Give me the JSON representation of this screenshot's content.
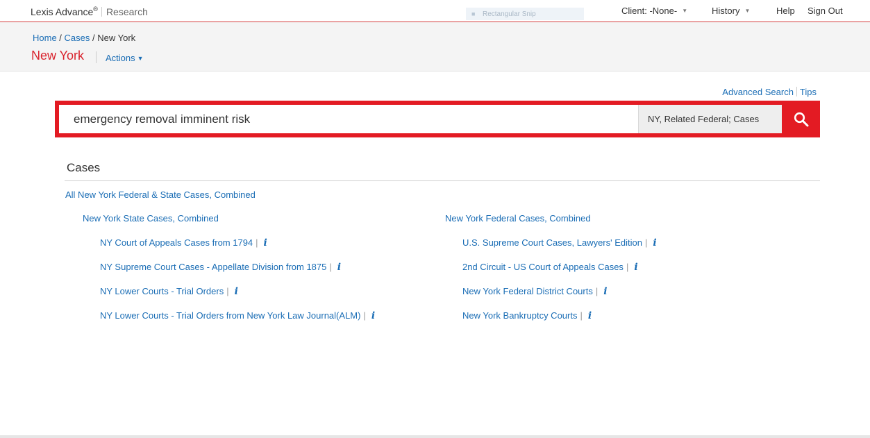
{
  "topbar": {
    "brand": "Lexis Advance",
    "brand_mark": "®",
    "product": "Research",
    "snip_label": "Rectangular Snip",
    "client_label": "Client: -None-",
    "history_label": "History",
    "help_label": "Help",
    "signout_label": "Sign Out"
  },
  "header": {
    "breadcrumb": {
      "home": "Home",
      "sep1": " / ",
      "cases": "Cases",
      "sep2": " / ",
      "current": "New York"
    },
    "title": "New York",
    "actions_label": "Actions"
  },
  "search": {
    "advanced_label": "Advanced Search",
    "tips_label": "Tips",
    "query": "emergency removal imminent risk",
    "scope": "NY, Related Federal; Cases"
  },
  "cases": {
    "heading": "Cases",
    "all_combined": "All New York Federal & State Cases, Combined",
    "state": {
      "combined": "New York State Cases, Combined",
      "items": [
        {
          "label": "NY Court of Appeals Cases from 1794"
        },
        {
          "label": "NY Supreme Court Cases - Appellate Division from 1875"
        },
        {
          "label": "NY Lower Courts - Trial Orders"
        },
        {
          "label": "NY Lower Courts - Trial Orders from New York Law Journal(ALM)"
        }
      ]
    },
    "federal": {
      "combined": "New York Federal Cases, Combined",
      "items": [
        {
          "label": "U.S. Supreme Court Cases, Lawyers' Edition"
        },
        {
          "label": "2nd Circuit - US Court of Appeals Cases"
        },
        {
          "label": "New York Federal District Courts"
        },
        {
          "label": "New York Bankruptcy Courts"
        }
      ]
    },
    "pipe": "|",
    "info_glyph": "i"
  },
  "colors": {
    "accent": "#e31b23",
    "link": "#1a6db5",
    "title": "#d9232d"
  },
  "icons": {
    "search": "search-icon",
    "info": "info-icon",
    "caret": "chevron-down-icon"
  }
}
